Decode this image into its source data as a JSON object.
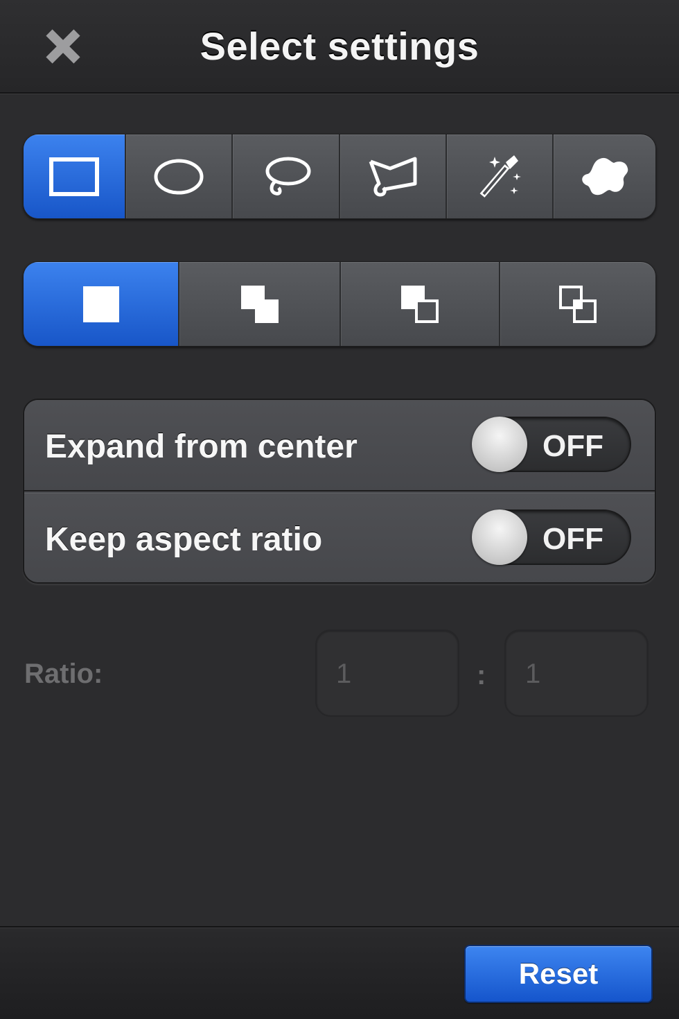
{
  "header": {
    "title": "Select settings",
    "close_icon": "close-icon"
  },
  "tools": {
    "active_index": 0,
    "items": [
      {
        "name": "rectangle-select",
        "icon": "rectangle-icon"
      },
      {
        "name": "ellipse-select",
        "icon": "ellipse-icon"
      },
      {
        "name": "lasso-select",
        "icon": "lasso-icon"
      },
      {
        "name": "polygon-lasso-select",
        "icon": "polygon-lasso-icon"
      },
      {
        "name": "magic-wand-select",
        "icon": "magic-wand-icon"
      },
      {
        "name": "shape-select",
        "icon": "blob-icon"
      }
    ]
  },
  "modes": {
    "active_index": 0,
    "items": [
      {
        "name": "new-selection",
        "icon": "new-selection-icon"
      },
      {
        "name": "add-selection",
        "icon": "add-selection-icon"
      },
      {
        "name": "subtract-selection",
        "icon": "subtract-selection-icon"
      },
      {
        "name": "intersect-selection",
        "icon": "intersect-selection-icon"
      }
    ]
  },
  "settings": {
    "expand_from_center": {
      "label": "Expand from center",
      "state": "OFF"
    },
    "keep_aspect_ratio": {
      "label": "Keep aspect ratio",
      "state": "OFF"
    }
  },
  "ratio": {
    "label": "Ratio:",
    "width": "1",
    "separator": ":",
    "height": "1"
  },
  "footer": {
    "reset_label": "Reset"
  },
  "colors": {
    "accent": "#2a6de0",
    "background": "#2c2c2e"
  }
}
